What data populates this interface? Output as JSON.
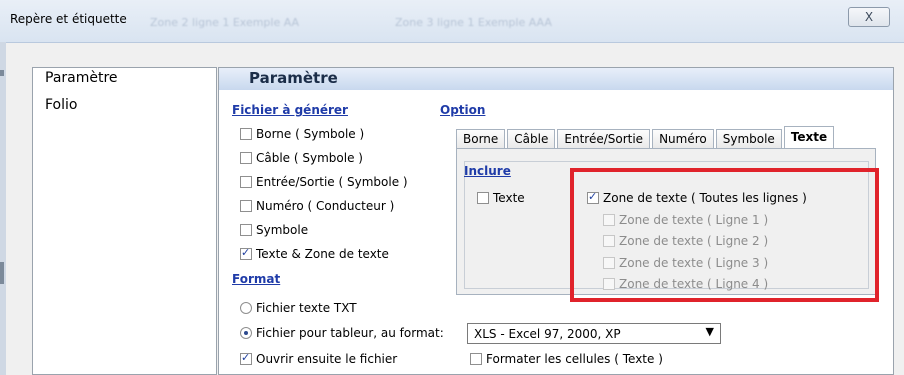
{
  "window": {
    "title": "Repère et étiquette",
    "close_glyph": "X"
  },
  "ghost_text": [
    "Zone 2 ligne 1 Exemple AA",
    "Zone 3 ligne 1 Exemple AAA"
  ],
  "left_nav": [
    "Paramètre",
    "Folio"
  ],
  "header": "Paramètre",
  "fichier": {
    "title": "Fichier à générer",
    "items": [
      {
        "label": "Borne ( Symbole )",
        "checked": false
      },
      {
        "label": "Câble ( Symbole )",
        "checked": false
      },
      {
        "label": "Entrée/Sortie ( Symbole )",
        "checked": false
      },
      {
        "label": "Numéro ( Conducteur )",
        "checked": false
      },
      {
        "label": "Symbole",
        "checked": false
      },
      {
        "label": "Texte & Zone de texte",
        "checked": true
      }
    ]
  },
  "format": {
    "title": "Format",
    "radio_txt": "Fichier texte TXT",
    "radio_tableur": "Fichier pour tableur, au format:",
    "select_value": "XLS - Excel 97, 2000, XP",
    "ouvrir": "Ouvrir ensuite le fichier",
    "formater": "Formater les cellules ( Texte )"
  },
  "option": {
    "title": "Option",
    "tabs": [
      "Borne",
      "Câble",
      "Entrée/Sortie",
      "Numéro",
      "Symbole",
      "Texte"
    ],
    "active_tab": "Texte",
    "inclure": "Inclure",
    "texte_label": "Texte",
    "zone_all": "Zone de texte ( Toutes les lignes )",
    "zone_lines": [
      "Zone de texte ( Ligne 1 )",
      "Zone de texte ( Ligne 2 )",
      "Zone de texte ( Ligne 3 )",
      "Zone de texte ( Ligne 4 )"
    ]
  },
  "colors": {
    "highlight_box": "#e0232b",
    "section_title": "#1f3ba8"
  }
}
